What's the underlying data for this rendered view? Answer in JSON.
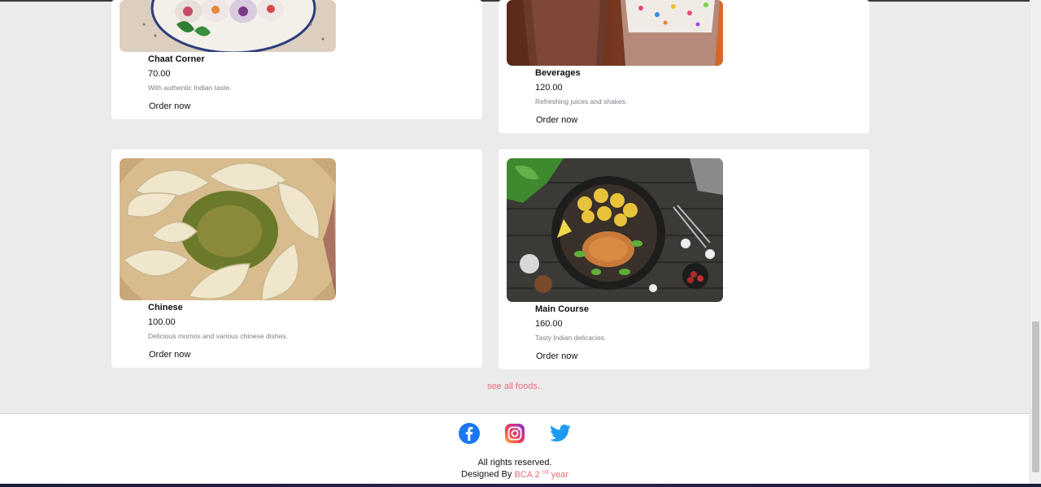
{
  "cards": [
    {
      "title": "Chaat Corner",
      "price": "70.00",
      "description": "With authentic Indian taste.",
      "order_label": "Order now",
      "image": "spring-rolls-photo"
    },
    {
      "title": "Beverages",
      "price": "120.00",
      "description": "Refreshing juices and shakes.",
      "order_label": "Order now",
      "image": "beverages-photo"
    },
    {
      "title": "Chinese",
      "price": "100.00",
      "description": "Delicious momos and various chinese dishes.",
      "order_label": "Order now",
      "image": "momos-photo"
    },
    {
      "title": "Main Course",
      "price": "160.00",
      "description": "Tasty Indian delicacies.",
      "order_label": "Order now",
      "image": "main-course-photo"
    }
  ],
  "see_all_label": "see all foods..",
  "footer": {
    "social_icons": [
      "facebook-icon",
      "instagram-icon",
      "twitter-icon"
    ],
    "rights_text": "All rights reserved.",
    "designed_prefix": "Designed By",
    "designed_accent": "BCA 2",
    "designed_sup": "nd",
    "designed_suffix": "year"
  },
  "colors": {
    "accent": "#f06a7a",
    "background": "#ebebeb",
    "facebook": "#1877f2",
    "twitter": "#1d9bf0"
  }
}
